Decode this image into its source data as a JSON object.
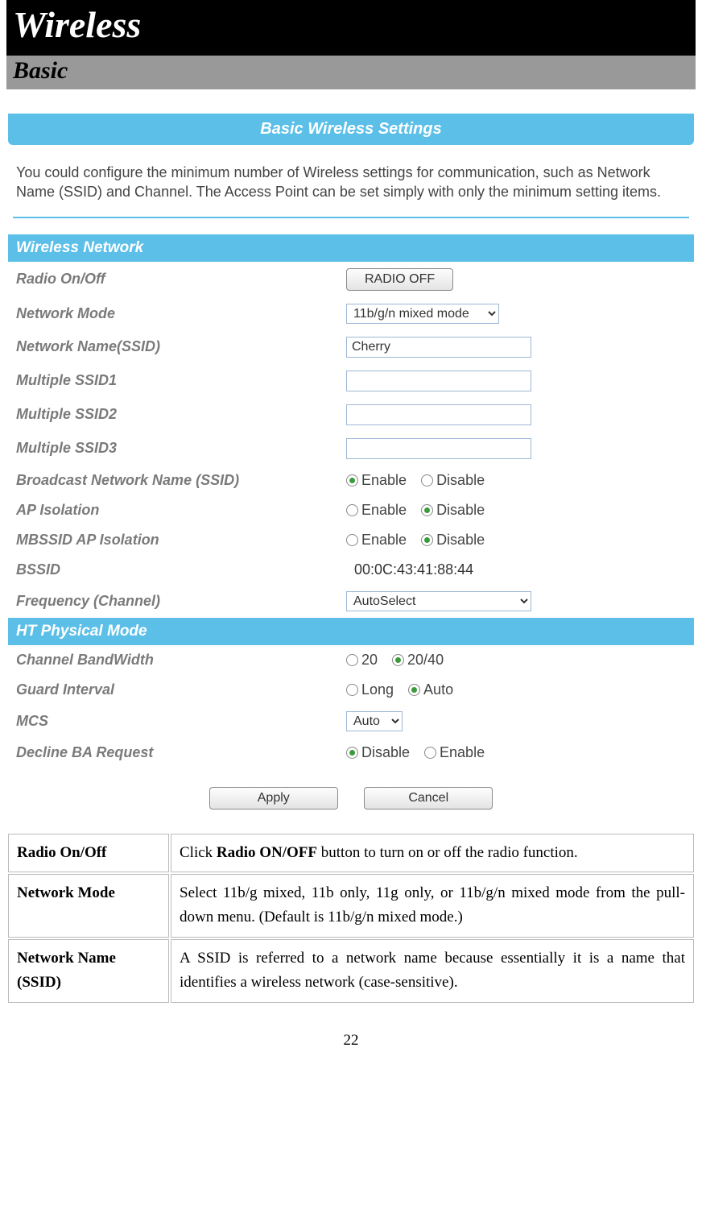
{
  "header": {
    "title": "Wireless",
    "subtitle": "Basic"
  },
  "panel": {
    "title": "Basic Wireless Settings",
    "intro": "You could configure the minimum number of Wireless settings for communication, such as Network Name (SSID) and Channel. The Access Point can be set simply with only the minimum setting items."
  },
  "wireless": {
    "section": "Wireless Network",
    "radio_label": "Radio On/Off",
    "radio_button": "RADIO OFF",
    "mode_label": "Network Mode",
    "mode_value": "11b/g/n mixed mode",
    "ssid_label": "Network Name(SSID)",
    "ssid_value": "Cherry",
    "mssid1_label": "Multiple SSID1",
    "mssid1_value": "",
    "mssid2_label": "Multiple SSID2",
    "mssid2_value": "",
    "mssid3_label": "Multiple SSID3",
    "mssid3_value": "",
    "broadcast_label": "Broadcast Network Name (SSID)",
    "apiso_label": "AP Isolation",
    "mbssid_label": "MBSSID AP Isolation",
    "bssid_label": "BSSID",
    "bssid_value": "00:0C:43:41:88:44",
    "freq_label": "Frequency (Channel)",
    "freq_value": "AutoSelect",
    "enable": "Enable",
    "disable": "Disable"
  },
  "ht": {
    "section": "HT Physical Mode",
    "cbw_label": "Channel BandWidth",
    "cbw_20": "20",
    "cbw_2040": "20/40",
    "gi_label": "Guard Interval",
    "gi_long": "Long",
    "gi_auto": "Auto",
    "mcs_label": "MCS",
    "mcs_value": "Auto",
    "decline_label": "Decline BA Request"
  },
  "buttons": {
    "apply": "Apply",
    "cancel": "Cancel"
  },
  "desc": {
    "r1k": "Radio On/Off",
    "r1a": "Click ",
    "r1b": "Radio ON/OFF",
    "r1c": " button to turn on or off the radio function.",
    "r2k": "Network Mode",
    "r2v": "Select 11b/g mixed, 11b only, 11g only, or 11b/g/n mixed mode from the pull-down menu. (Default is 11b/g/n mixed mode.)",
    "r3k": "Network Name (SSID)",
    "r3v": "A SSID is referred to a network name because essentially it is a name that identifies a wireless network (case-sensitive)."
  },
  "page_number": "22"
}
